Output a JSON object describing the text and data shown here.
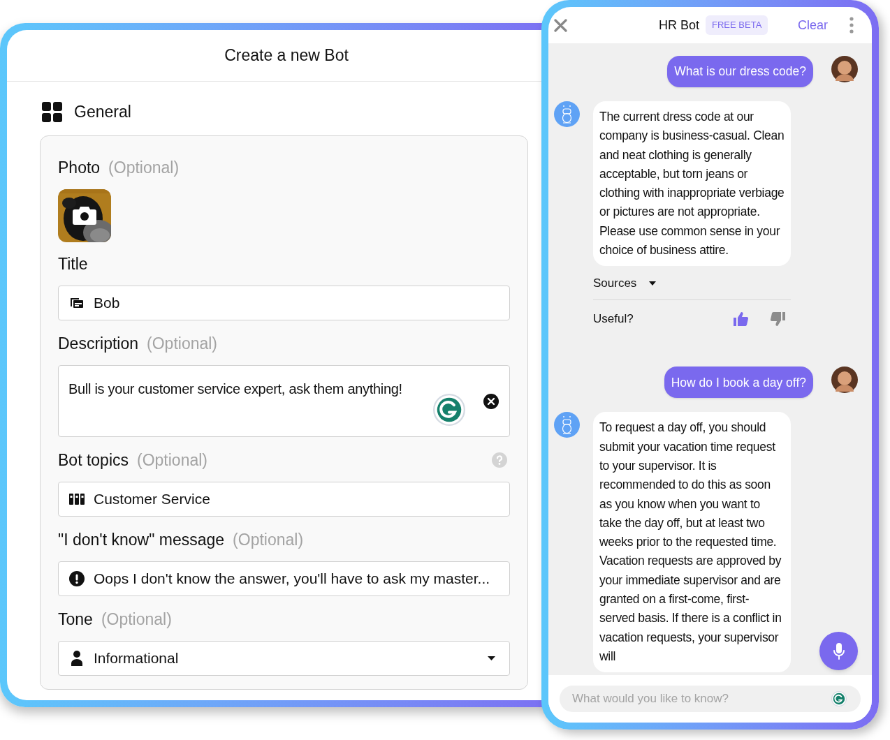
{
  "form": {
    "title": "Create a new Bot",
    "section": "General",
    "fields": [
      {
        "label": "Photo",
        "note": "(Optional)"
      },
      {
        "kind": "input",
        "label": "Title",
        "value": "Bob"
      },
      {
        "kind": "textarea",
        "label": "Description",
        "note": "(Optional)",
        "value": "Bull is your customer service expert, ask them anything!"
      },
      {
        "kind": "input",
        "label": "Bot topics",
        "note": "(Optional)",
        "value": "Customer Service",
        "help": true
      },
      {
        "kind": "input",
        "label": "\"I don't know\" message",
        "note": "(Optional)",
        "value": "Oops I don't know the answer, you'll have to ask my master..."
      },
      {
        "kind": "select",
        "label": "Tone",
        "note": "(Optional)",
        "value": "Informational"
      }
    ]
  },
  "chat": {
    "title": "HR Bot",
    "badge": "FREE BETA",
    "clear": "Clear",
    "messages": [
      {
        "kind": "user",
        "text": "What is our dress code?"
      },
      {
        "kind": "bot",
        "text": "The current dress code at our company is business-casual. Clean and neat clothing is generally acceptable, but torn jeans or clothing with inappropriate verbiage or pictures are not appropriate. Please use common sense in your choice of business attire.",
        "sources": "Sources",
        "useful": "Useful?",
        "liked": true,
        "disliked": false
      },
      {
        "kind": "user",
        "text": "How do I book a day off?"
      },
      {
        "kind": "bot",
        "text": "To request a day off, you should submit your vacation time request to your supervisor. It is recommended to do this as soon as you know when you want to take the day off, but at least two weeks prior to the requested time. Vacation requests are approved by your immediate supervisor and are granted on a first-come, first-served basis. If there is a conflict in vacation requests, your supervisor will"
      }
    ],
    "placeholder": "What would you like to know?"
  }
}
